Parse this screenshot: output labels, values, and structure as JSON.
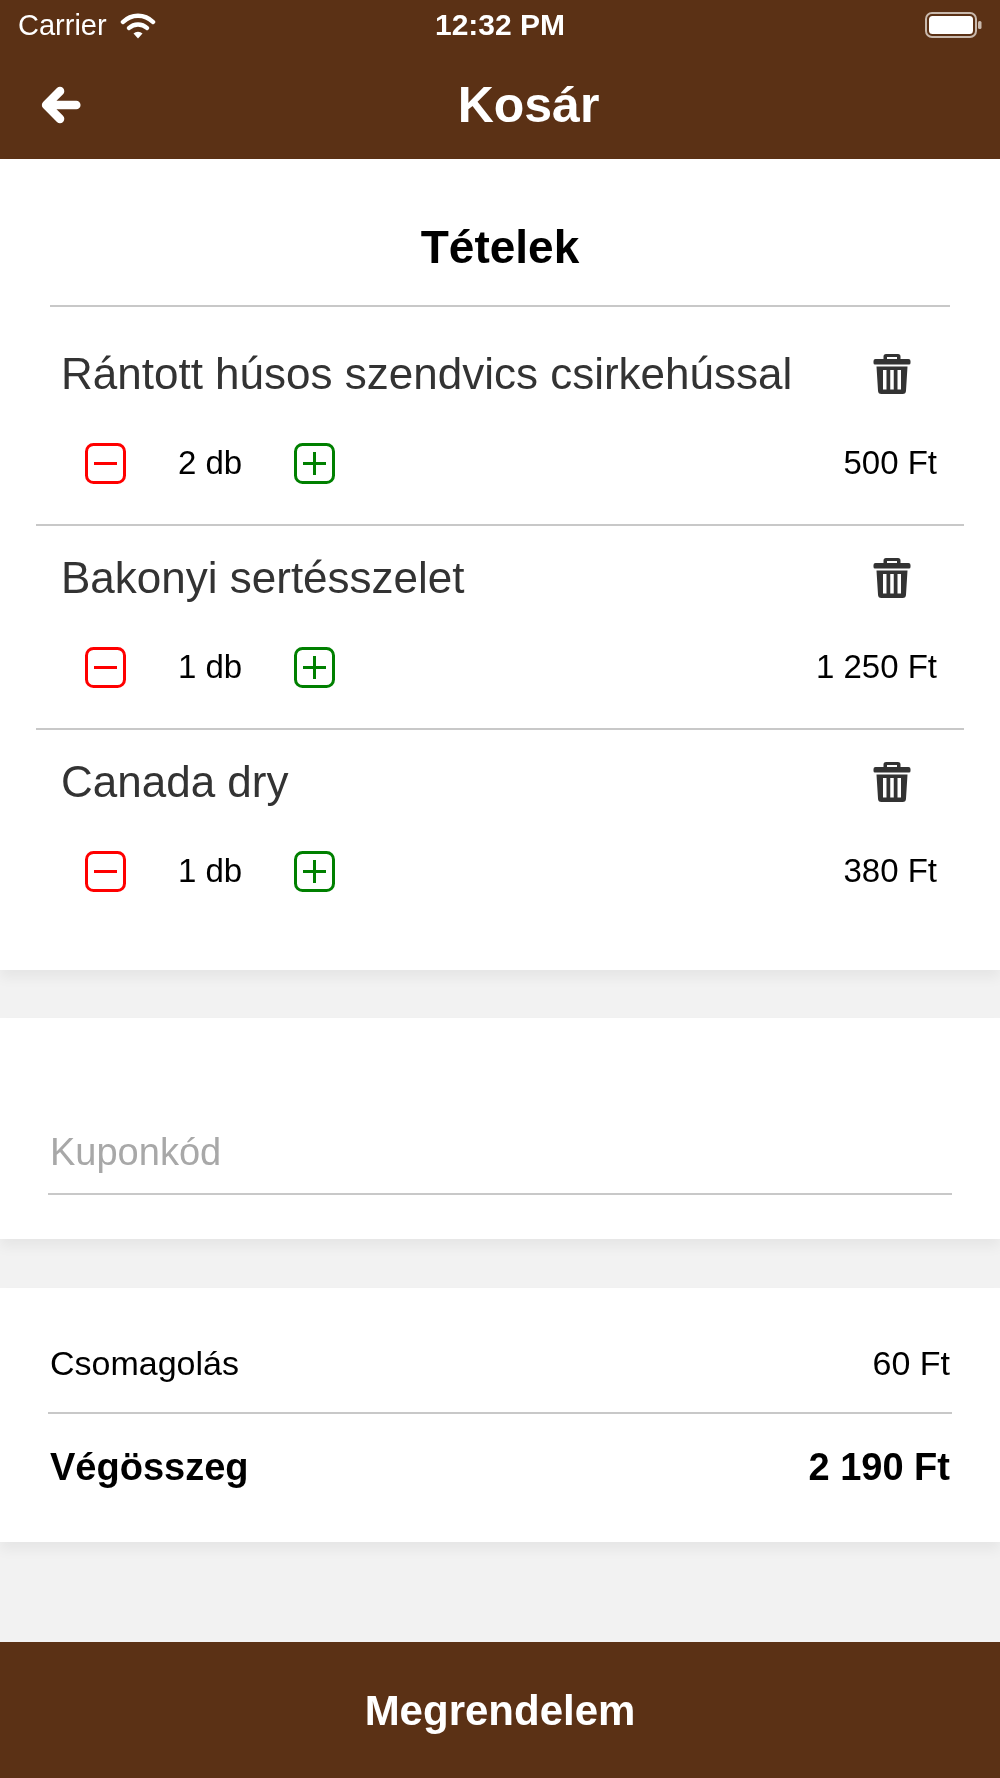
{
  "status_bar": {
    "carrier": "Carrier",
    "time": "12:32 PM"
  },
  "header": {
    "title": "Kosár"
  },
  "items_section": {
    "title": "Tételek",
    "items": [
      {
        "name": "Rántott húsos szendvics csirkehússal",
        "quantity": "2 db",
        "price": "500 Ft"
      },
      {
        "name": "Bakonyi sertésszelet",
        "quantity": "1 db",
        "price": "1 250 Ft"
      },
      {
        "name": "Canada dry",
        "quantity": "1 db",
        "price": "380 Ft"
      }
    ]
  },
  "coupon": {
    "placeholder": "Kuponkód"
  },
  "summary": [
    {
      "kind": "line",
      "label": "Csomagolás",
      "value": "60 Ft"
    },
    {
      "kind": "total",
      "label": "Végösszeg",
      "value": "2 190 Ft"
    }
  ],
  "order_button": {
    "label": "Megrendelem"
  }
}
